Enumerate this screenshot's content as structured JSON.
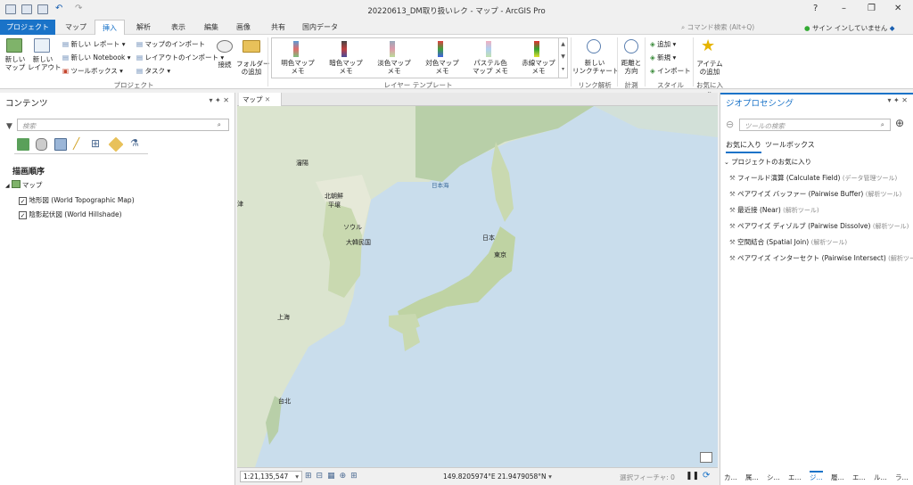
{
  "window": {
    "title": "20220613_DM取り扱いレク - マップ - ArcGIS Pro",
    "help": "?",
    "minimize": "–",
    "restore": "❐",
    "close": "✕"
  },
  "tabs": [
    "プロジェクト",
    "マップ",
    "挿入",
    "解析",
    "表示",
    "編集",
    "画像",
    "共有",
    "国内データ"
  ],
  "command_search": {
    "placeholder": "コマンド検索 (Alt+Q)"
  },
  "signin": "サイン インしていません",
  "ribbon": {
    "project": {
      "new_map": "新しい\nマップ",
      "new_layout": "新しい\nレイアウト",
      "new_report": "新しい レポート",
      "new_notebook": "新しい Notebook",
      "toolbox": "ツールボックス",
      "import_map": "マップのインポート",
      "import_layout": "レイアウトのインポート",
      "task": "タスク",
      "connect": "接続",
      "add_folder": "フォルダー\nの追加",
      "group": "プロジェクト"
    },
    "templates": {
      "items": [
        "明色マップ\nメモ",
        "暗色マップ\nメモ",
        "淡色マップ\nメモ",
        "対色マップ\nメモ",
        "パステル色\nマップ メモ",
        "赤線マップ\nメモ"
      ],
      "group": "レイヤー テンプレート"
    },
    "link": {
      "new_chart": "新しい\nリンクチャート",
      "group": "リンク解析"
    },
    "measure": {
      "dist": "距離と\n方向",
      "group": "計測"
    },
    "style": {
      "add": "追加",
      "new": "新規",
      "import": "インポート",
      "group": "スタイル"
    },
    "fav": {
      "add_item": "アイテム\nの追加",
      "group": "お気に入り"
    }
  },
  "contents": {
    "title": "コンテンツ",
    "search": "検索",
    "draw_order": "描画順序",
    "map": "マップ",
    "layers": [
      "地形図 (World Topographic Map)",
      "陰影起伏図 (World Hillshade)"
    ]
  },
  "map": {
    "tab": "マップ",
    "labels": [
      "瀋陽",
      "北朝鮮",
      "平壌",
      "ソウル",
      "大韓民国",
      "日本海",
      "日本",
      "東京",
      "上海",
      "台北",
      "津"
    ]
  },
  "status": {
    "scale": "1:21,135,547",
    "coords": "149.8205974°E 21.9479058°N",
    "selected": "選択フィーチャ: 0"
  },
  "geo": {
    "title": "ジオプロセシング",
    "search": "ツールの検索",
    "tab_fav": "お気に入り",
    "tab_tb": "ツールボックス",
    "group": "プロジェクトのお気に入り",
    "items": [
      [
        "フィールド演算 (Calculate Field)",
        "(データ管理ツール)"
      ],
      [
        "ペアワイズ バッファー (Pairwise Buffer)",
        "(解析ツール)"
      ],
      [
        "最近接 (Near)",
        "(解析ツール)"
      ],
      [
        "ペアワイズ ディゾルブ (Pairwise Dissolve)",
        "(解析ツール)"
      ],
      [
        "空間結合 (Spatial Join)",
        "(解析ツール)"
      ],
      [
        "ペアワイズ インターセクト (Pairwise Intersect)",
        "(解析ツール)"
      ]
    ],
    "bottom_tabs": [
      "カ...",
      "属...",
      "シ...",
      "エ...",
      "ジ...",
      "履...",
      "エ...",
      "ル...",
      "ラ..."
    ]
  }
}
